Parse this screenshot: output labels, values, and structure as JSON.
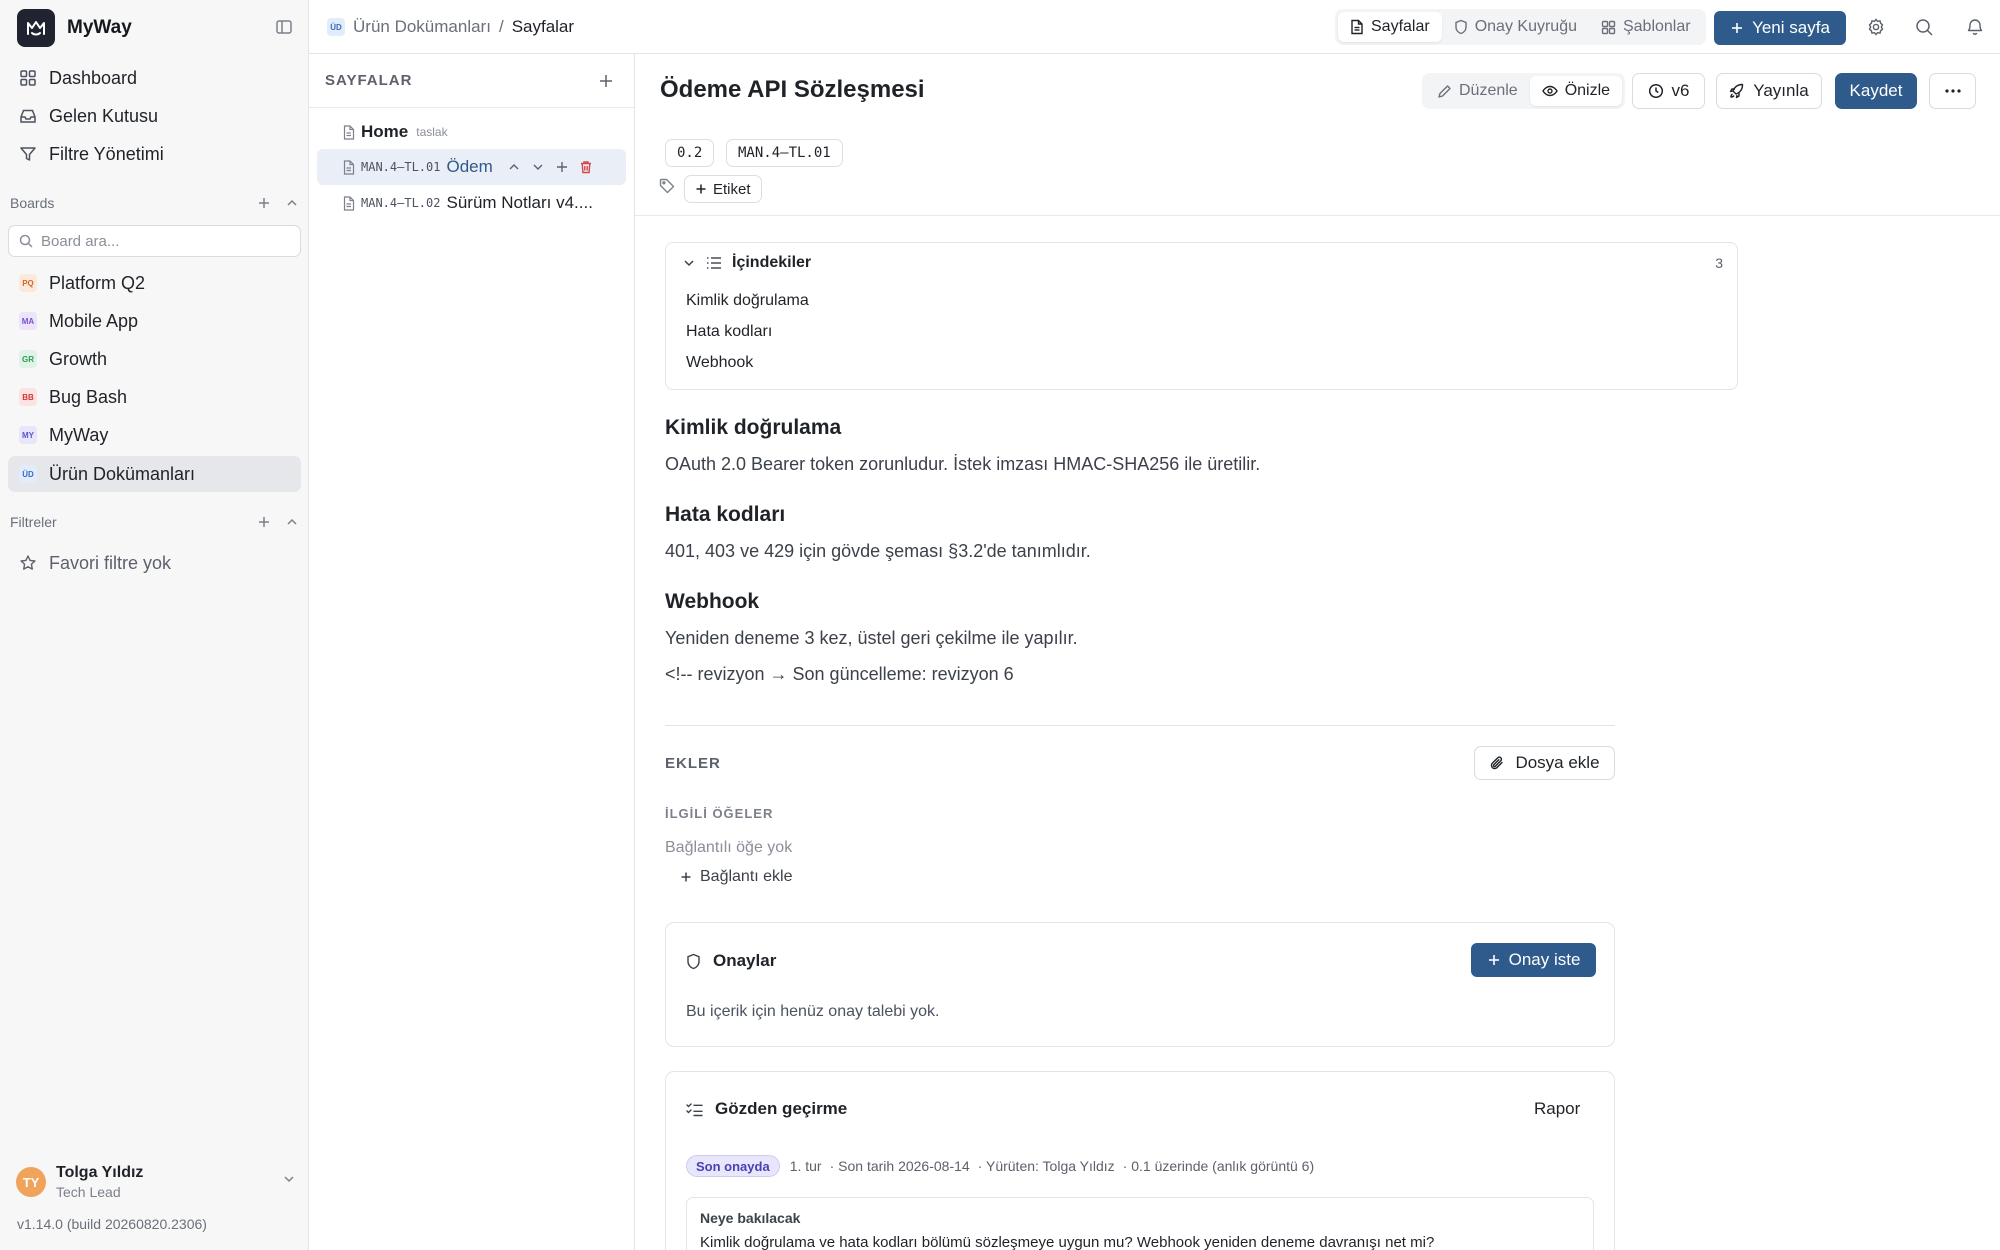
{
  "app": {
    "name": "MyWay"
  },
  "sidebar": {
    "nav": [
      {
        "label": "Dashboard",
        "icon": "grid-icon"
      },
      {
        "label": "Gelen Kutusu",
        "icon": "inbox-icon"
      },
      {
        "label": "Filtre Yönetimi",
        "icon": "filter-icon"
      }
    ],
    "boards_title": "Boards",
    "board_search_placeholder": "Board ara...",
    "boards": [
      {
        "badge": "PQ",
        "label": "Platform Q2",
        "bg": "#fde8dc",
        "fg": "#d0692c"
      },
      {
        "badge": "MA",
        "label": "Mobile App",
        "bg": "#ebe4fb",
        "fg": "#7b4fd0"
      },
      {
        "badge": "GR",
        "label": "Growth",
        "bg": "#dff4e6",
        "fg": "#2f9a57"
      },
      {
        "badge": "BB",
        "label": "Bug Bash",
        "bg": "#fde2e2",
        "fg": "#cc3a3a"
      },
      {
        "badge": "MY",
        "label": "MyWay",
        "bg": "#e7e6fb",
        "fg": "#5b57c9"
      },
      {
        "badge": "ÜD",
        "label": "Ürün Dokümanları",
        "bg": "#e3ecfa",
        "fg": "#3a6bc4"
      }
    ],
    "filters_title": "Filtreler",
    "favorite_filters_empty": "Favori filtre yok",
    "user": {
      "initials": "TY",
      "name": "Tolga Yıldız",
      "role": "Tech Lead"
    },
    "version": "v1.14.0 (build 20260820.2306)"
  },
  "topbar": {
    "crumb_badge": "ÜD",
    "crumb_parent": "Ürün Dokümanları",
    "crumb_sep": "/",
    "crumb_current": "Sayfalar",
    "tabs": [
      {
        "label": "Sayfalar",
        "icon": "file-icon",
        "active": true
      },
      {
        "label": "Onay Kuyruğu",
        "icon": "shield-icon",
        "active": false
      },
      {
        "label": "Şablonlar",
        "icon": "template-grid-icon",
        "active": false
      }
    ],
    "new_page": "Yeni sayfa"
  },
  "pages_panel": {
    "title": "SAYFALAR",
    "items": [
      {
        "code": "",
        "title": "Home",
        "sub": "taslak"
      },
      {
        "code": "MAN.4–TL.01",
        "title": "Ödem",
        "sub": ""
      },
      {
        "code": "MAN.4–TL.02",
        "title": "Sürüm Notları v4....",
        "sub": ""
      }
    ]
  },
  "doc": {
    "title": "Ödeme API Sözleşmesi",
    "actions": {
      "edit": "Düzenle",
      "preview": "Önizle",
      "version": "v6",
      "publish": "Yayınla",
      "save": "Kaydet"
    },
    "chips": [
      "0.2",
      "MAN.4–TL.01"
    ],
    "tag_button": "Etiket",
    "toc": {
      "title": "İçindekiler",
      "count": "3",
      "items": [
        "Kimlik doğrulama",
        "Hata kodları",
        "Webhook"
      ]
    },
    "sections": [
      {
        "heading": "Kimlik doğrulama",
        "body": "OAuth 2.0 Bearer token zorunludur. İstek imzası HMAC-SHA256 ile üretilir."
      },
      {
        "heading": "Hata kodları",
        "body": "401, 403 ve 429 için gövde şeması §3.2'de tanımlıdır."
      },
      {
        "heading": "Webhook",
        "body": "Yeniden deneme 3 kez, üstel geri çekilme ile yapılır.",
        "body2": "<!-- revizyon → Son güncelleme: revizyon 6"
      }
    ],
    "attachments": {
      "title": "EKLER",
      "button": "Dosya ekle"
    },
    "related": {
      "title": "İLGİLİ ÖĞELER",
      "empty": "Bağlantılı öğe yok",
      "add": "Bağlantı ekle"
    },
    "approvals": {
      "title": "Onaylar",
      "button": "Onay iste",
      "empty": "Bu içerik için henüz onay talebi yok."
    },
    "review": {
      "title": "Gözden geçirme",
      "report": "Rapor",
      "status": "Son onayda",
      "round": "1. tur",
      "due": "· Son tarih 2026-08-14",
      "owner": "· Yürüten: Tolga Yıldız",
      "basis": "· 0.1 üzerinde (anlık görüntü 6)",
      "look_label": "Neye bakılacak",
      "look_text": "Kimlik doğrulama ve hata kodları bölümü sözleşmeye uygun mu? Webhook yeniden deneme davranışı net mi?"
    }
  }
}
